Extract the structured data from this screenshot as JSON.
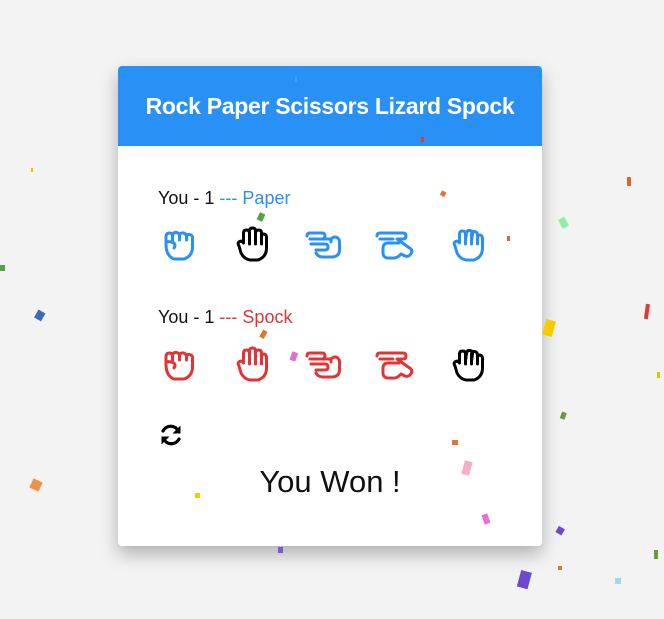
{
  "app": {
    "title": "Rock Paper Scissors Lizard Spock"
  },
  "player1": {
    "name": "You",
    "score": "1",
    "separator": "---",
    "choice": "Paper",
    "color": "#2990f5",
    "selected_index": 1,
    "hands": [
      "rock-icon",
      "paper-icon",
      "scissors-icon",
      "lizard-icon",
      "spock-icon"
    ]
  },
  "player2": {
    "name": "You",
    "score": "1",
    "separator": "---",
    "choice": "Spock",
    "color": "#e23434",
    "selected_index": 4,
    "hands": [
      "rock-icon",
      "paper-icon",
      "scissors-icon",
      "lizard-icon",
      "spock-icon"
    ]
  },
  "controls": {
    "restart_icon": "refresh-icon"
  },
  "result": {
    "text": "You Won !"
  },
  "theme": {
    "header": "#2990f5",
    "background": "#f3f3f3",
    "selected": "#000000"
  }
}
